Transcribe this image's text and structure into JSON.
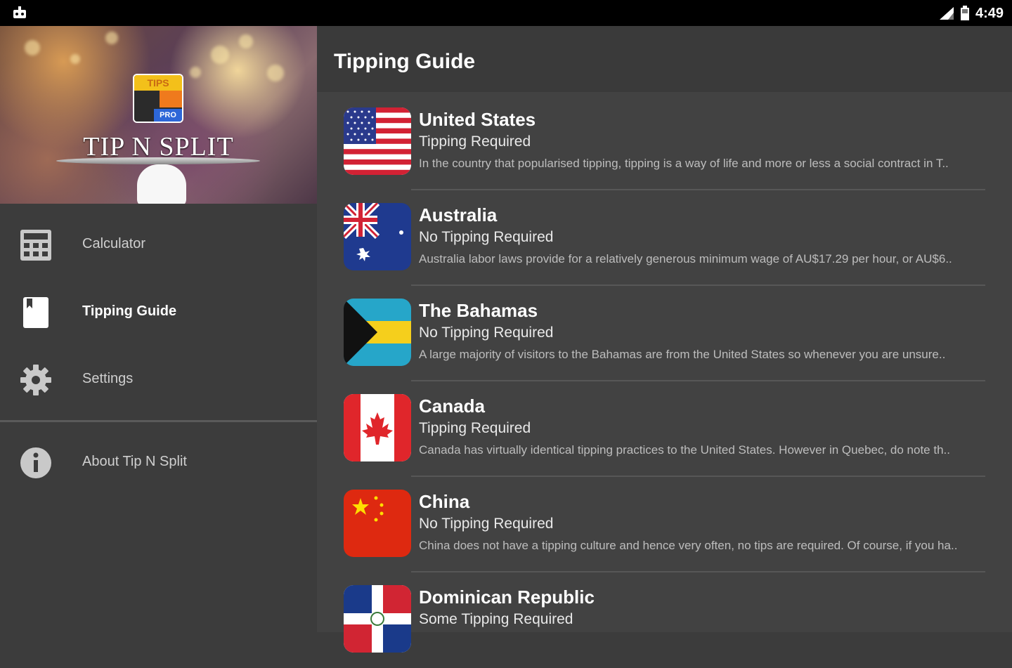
{
  "status_bar": {
    "time": "4:49",
    "icons": [
      "android-notification-icon",
      "signal-icon",
      "battery-icon"
    ]
  },
  "drawer": {
    "header": {
      "logo_top_text": "TIPS",
      "logo_badge_text": "PRO",
      "app_name": "TIP N SPLIT"
    },
    "items": [
      {
        "label": "Calculator",
        "icon": "calculator-icon",
        "active": false
      },
      {
        "label": "Tipping Guide",
        "icon": "book-icon",
        "active": true
      },
      {
        "label": "Settings",
        "icon": "gear-icon",
        "active": false
      },
      {
        "label": "About Tip N Split",
        "icon": "info-icon",
        "active": false
      }
    ]
  },
  "main": {
    "title": "Tipping Guide",
    "countries": [
      {
        "name": "United States",
        "status": "Tipping Required",
        "summary": "In the country that popularised tipping, tipping is a way of life and more or less a social contract in T..",
        "flag": "us-flag-icon"
      },
      {
        "name": "Australia",
        "status": "No Tipping Required",
        "summary": "Australia labor laws provide for a relatively generous minimum wage of AU$17.29 per hour, or AU$6..",
        "flag": "australia-flag-icon"
      },
      {
        "name": "The Bahamas",
        "status": "No Tipping Required",
        "summary": "A large majority of visitors to the Bahamas are from the United States so whenever you are unsure..",
        "flag": "bahamas-flag-icon"
      },
      {
        "name": "Canada",
        "status": "Tipping Required",
        "summary": "Canada has virtually identical tipping practices to the United States. However in Quebec, do note th..",
        "flag": "canada-flag-icon"
      },
      {
        "name": "China",
        "status": "No Tipping Required",
        "summary": "China does not have a tipping culture and hence very often, no tips are required. Of course, if you ha..",
        "flag": "china-flag-icon"
      },
      {
        "name": "Dominican Republic",
        "status": "Some Tipping Required",
        "summary": "",
        "flag": "dominican-republic-flag-icon"
      }
    ]
  },
  "colors": {
    "status_bar": "#000000",
    "drawer_bg": "#3c3c3c",
    "main_bg": "#424242",
    "toolbar_bg": "#3a3a3a"
  }
}
